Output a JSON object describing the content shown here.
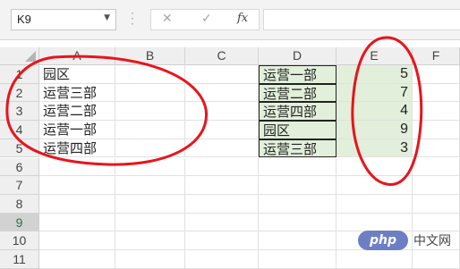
{
  "formula_bar": {
    "name_box": "K9",
    "cancel_icon": "✕",
    "enter_icon": "✓",
    "function_icon": "fx",
    "formula": ""
  },
  "sheet": {
    "columns": [
      "A",
      "B",
      "C",
      "D",
      "E",
      "F"
    ],
    "rows": [
      "1",
      "2",
      "3",
      "4",
      "5",
      "6",
      "7",
      "8",
      "9",
      "10",
      "11"
    ],
    "selected_row": "9",
    "column_a": [
      "园区",
      "运营三部",
      "运营二部",
      "运营一部",
      "运营四部"
    ],
    "column_d": [
      "运营一部",
      "运营二部",
      "运营四部",
      "园区",
      "运营三部"
    ],
    "column_e": [
      "5",
      "7",
      "4",
      "9",
      "3"
    ]
  },
  "colors": {
    "highlight_fill": "#e2efda",
    "annotation_red": "#e8141c",
    "selected_row_text": "#217346"
  },
  "watermark": {
    "logo": "php",
    "text": "中文网"
  }
}
